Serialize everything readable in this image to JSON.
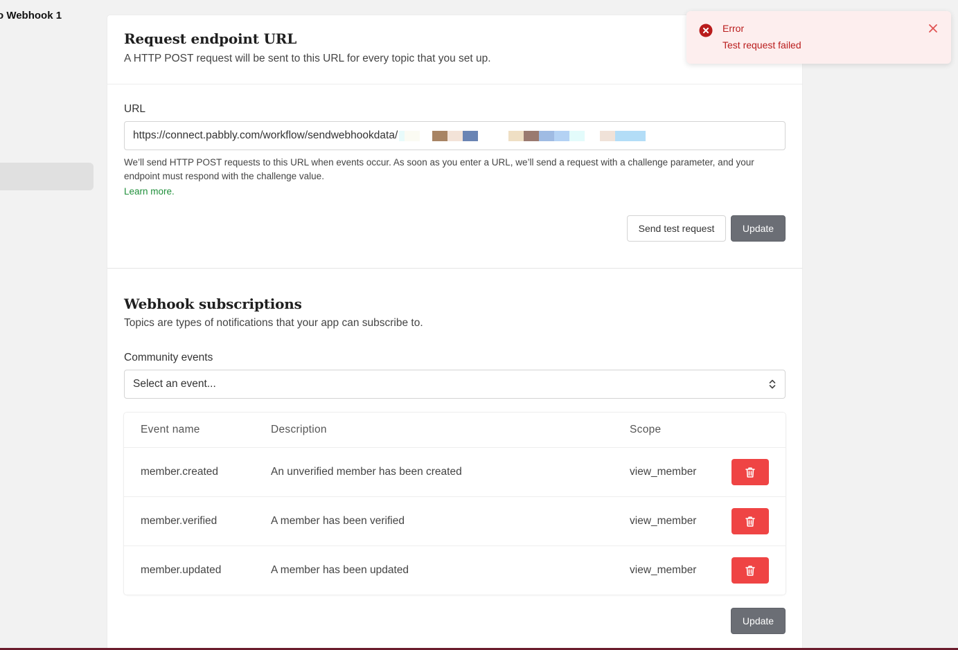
{
  "sidebar": {
    "title": "o Webhook 1"
  },
  "endpoint": {
    "title": "Request endpoint URL",
    "subtitle": "A HTTP POST request will be sent to this URL for every topic that you set up.",
    "url_label": "URL",
    "url_value": "https://connect.pabbly.com/workflow/sendwebhookdata/",
    "help_text": "We’ll send HTTP POST requests to this URL when events occur. As soon as you enter a URL, we’ll send a request with a challenge parameter, and your endpoint must respond with the challenge value.",
    "learn_more": "Learn more.",
    "send_test_label": "Send test request",
    "update_label": "Update"
  },
  "subscriptions": {
    "title": "Webhook subscriptions",
    "subtitle": "Topics are types of notifications that your app can subscribe to.",
    "events_label": "Community events",
    "select_placeholder": "Select an event...",
    "columns": [
      "Event name",
      "Description",
      "Scope"
    ],
    "rows": [
      {
        "event": "member.created",
        "description": "An unverified member has been created",
        "scope": "view_member"
      },
      {
        "event": "member.verified",
        "description": "A member has been verified",
        "scope": "view_member"
      },
      {
        "event": "member.updated",
        "description": "A member has been updated",
        "scope": "view_member"
      }
    ],
    "update_label": "Update"
  },
  "toast": {
    "title": "Error",
    "message": "Test request failed",
    "icon": "error-circle-icon",
    "close_icon": "close-icon"
  },
  "colors": {
    "error": "#b91c1c",
    "delete_button": "#ef4444",
    "update_button": "#6b6e75",
    "link": "#1f8f3a"
  }
}
